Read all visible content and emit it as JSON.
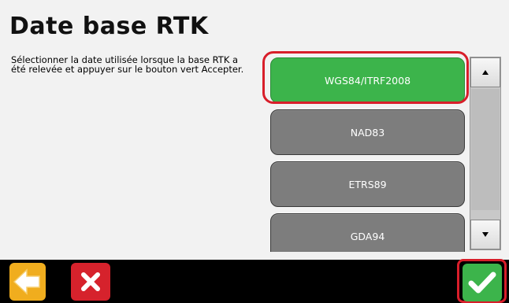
{
  "page": {
    "title": "Date base RTK",
    "instructions": "Sélectionner la date utilisée lorsque la base RTK a été relevée et appuyer sur le bouton vert Accepter."
  },
  "datums": {
    "options": [
      {
        "label": "WGS84/ITRF2008",
        "selected": true
      },
      {
        "label": "NAD83",
        "selected": false
      },
      {
        "label": "ETRS89",
        "selected": false
      },
      {
        "label": "GDA94",
        "selected": false
      }
    ]
  },
  "scrollbar": {
    "up_icon": "triangle-up",
    "down_icon": "triangle-down"
  },
  "footer": {
    "back_icon": "arrow-left-icon",
    "cancel_icon": "x-icon",
    "accept_icon": "check-icon"
  },
  "colors": {
    "selected": "#3cb44b",
    "unselected": "#7d7d7d",
    "highlight": "#d81e2a",
    "back": "#f0ad1e",
    "cancel": "#d6222c",
    "accept": "#3cb44b"
  }
}
